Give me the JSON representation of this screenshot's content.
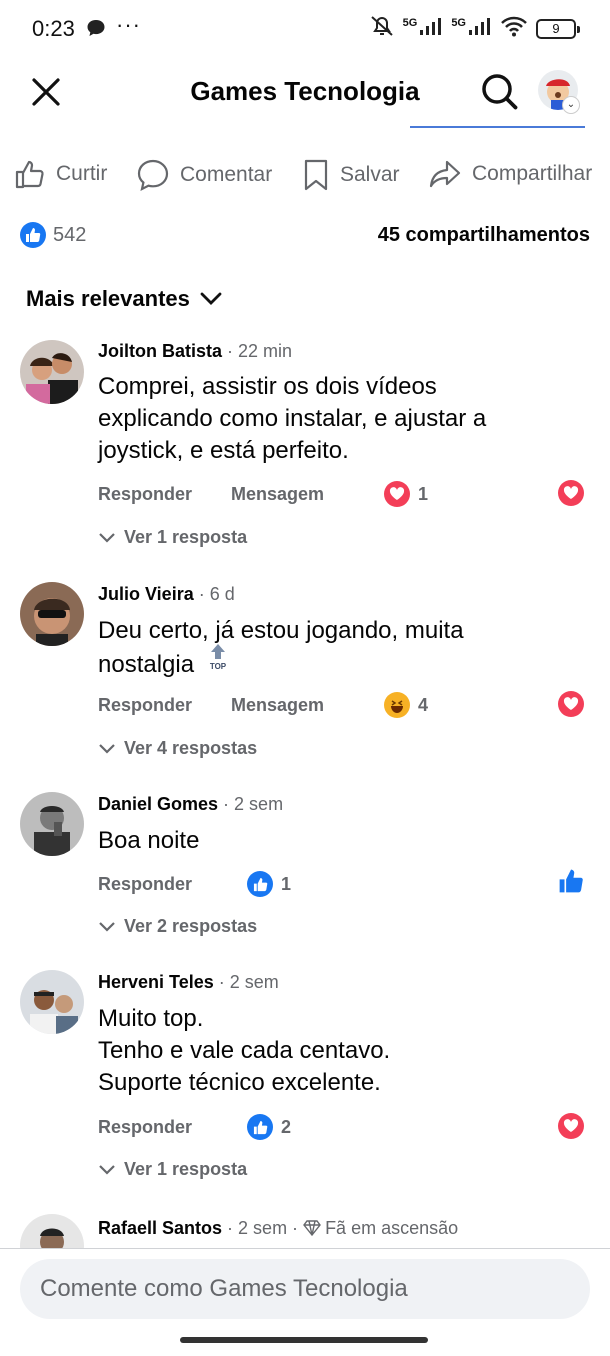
{
  "status_bar": {
    "time": "0:23",
    "dots": "···",
    "net1": "5G",
    "net2": "5G",
    "battery": "9"
  },
  "header": {
    "title": "Games Tecnologia"
  },
  "actions": {
    "like": "Curtir",
    "comment": "Comentar",
    "save": "Salvar",
    "share": "Compartilhar"
  },
  "stats": {
    "reactions": "542",
    "shares": "45 compartilhamentos"
  },
  "sort_label": "Mais relevantes",
  "comments": [
    {
      "name": "Joilton Batista",
      "time": " · 22 min",
      "text_lines": [
        "Comprei, assistir os dois vídeos",
        "explicando como instalar, e ajustar a",
        "joystick, e está perfeito."
      ],
      "reply": "Responder",
      "message": "Mensagem",
      "reaction": "love",
      "reaction_count": "1",
      "my_reaction": "love",
      "replies": "Ver 1 resposta"
    },
    {
      "name": "Julio Vieira",
      "time": " · 6 d",
      "text_lines": [
        "Deu certo, já estou jogando, muita",
        "nostalgia"
      ],
      "emoji_text": "TOP",
      "reply": "Responder",
      "message": "Mensagem",
      "reaction": "haha",
      "reaction_count": "4",
      "my_reaction": "love",
      "replies": "Ver 4 respostas"
    },
    {
      "name": "Daniel Gomes",
      "time": " · 2 sem",
      "text_lines": [
        "Boa noite"
      ],
      "reply": "Responder",
      "reaction": "like",
      "reaction_count": "1",
      "my_reaction": "like",
      "replies": "Ver 2 respostas"
    },
    {
      "name": "Herveni Teles",
      "time": " · 2 sem",
      "text_lines": [
        "Muito top.",
        "Tenho e vale cada centavo.",
        "Suporte técnico excelente."
      ],
      "reply": "Responder",
      "reaction": "like",
      "reaction_count": "2",
      "my_reaction": "love",
      "replies": "Ver 1 resposta"
    },
    {
      "name": "Rafaell Santos",
      "time": " · 2 sem · ",
      "badge": "Fã em ascensão"
    }
  ],
  "composer": {
    "placeholder": "Comente como Games Tecnologia"
  },
  "colors": {
    "facebook_blue": "#1877f2",
    "love_red": "#f33e58",
    "secondary_text": "#65676b"
  }
}
